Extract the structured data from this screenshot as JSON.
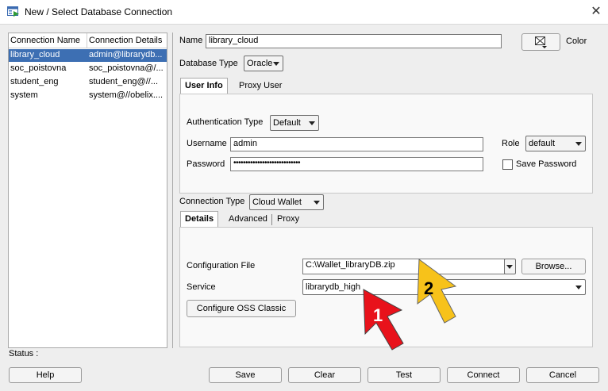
{
  "window": {
    "title": "New / Select Database Connection",
    "close_glyph": "✕"
  },
  "connections": {
    "headers": [
      "Connection Name",
      "Connection Details"
    ],
    "rows": [
      {
        "name": "library_cloud",
        "details": "admin@librarydb...",
        "selected": true
      },
      {
        "name": "soc_poistovna",
        "details": "soc_poistovna@/...",
        "selected": false
      },
      {
        "name": "student_eng",
        "details": "student_eng@//...",
        "selected": false
      },
      {
        "name": "system",
        "details": "system@//obelix....",
        "selected": false
      }
    ]
  },
  "form": {
    "name_label": "Name",
    "name_value": "library_cloud",
    "color_label": "Color",
    "db_type_label": "Database Type",
    "db_type_value": "Oracle",
    "tabs_top": [
      "User Info",
      "Proxy User"
    ],
    "auth_type_label": "Authentication Type",
    "auth_type_value": "Default",
    "username_label": "Username",
    "username_value": "admin",
    "password_label": "Password",
    "password_value": "••••••••••••••••••••••••••••",
    "role_label": "Role",
    "role_value": "default",
    "save_password_label": "Save Password",
    "conn_type_label": "Connection Type",
    "conn_type_value": "Cloud Wallet",
    "tabs_bottom": [
      "Details",
      "Advanced",
      "Proxy"
    ],
    "config_file_label": "Configuration File",
    "config_file_value": "C:\\Wallet_libraryDB.zip",
    "browse_label": "Browse...",
    "service_label": "Service",
    "service_value": "librarydb_high",
    "configure_oss_label": "Configure OSS Classic"
  },
  "status": {
    "label": "Status :"
  },
  "buttons": {
    "help": "Help",
    "save": "Save",
    "clear": "Clear",
    "test": "Test",
    "connect": "Connect",
    "cancel": "Cancel"
  },
  "annotations": {
    "arrow1_label": "1",
    "arrow1_color": "#e8121b",
    "arrow2_label": "2",
    "arrow2_color": "#f7c21a"
  }
}
